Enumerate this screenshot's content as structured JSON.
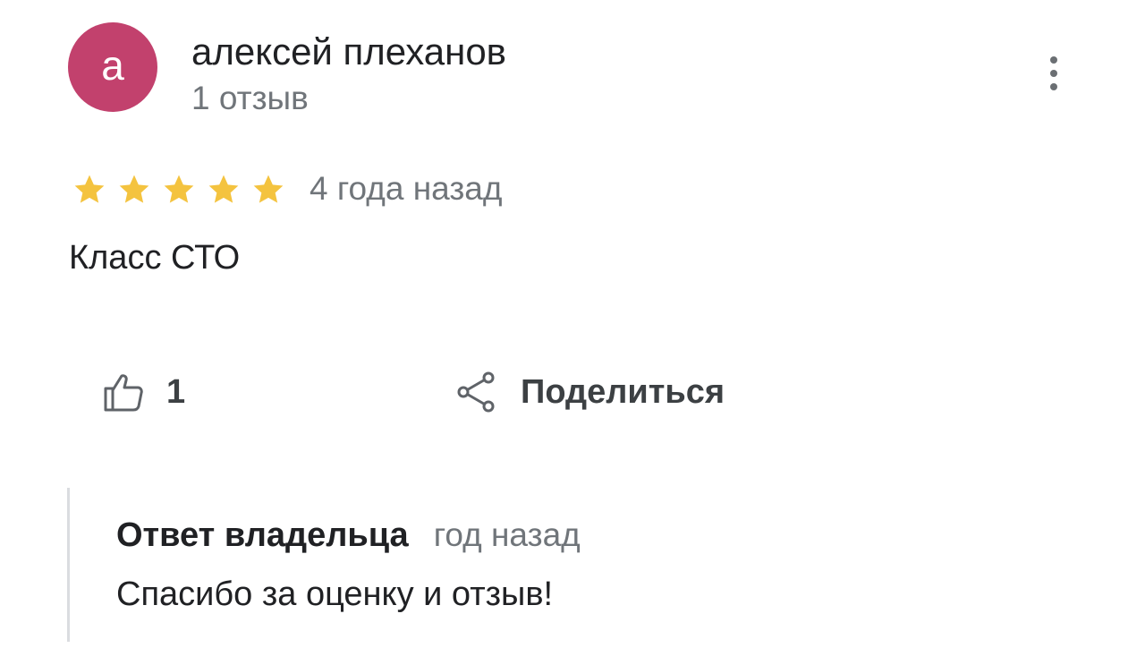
{
  "review": {
    "author": {
      "initial": "а",
      "name": "алексей плеханов",
      "meta": "1 отзыв",
      "avatar_color": "#c2416d"
    },
    "menu_icon": "more-vert-icon",
    "rating": 5,
    "rating_max": 5,
    "star_color": "#f4c33f",
    "date": "4 года назад",
    "text": "Класс СТО",
    "actions": {
      "like_icon": "thumbs-up-icon",
      "like_count": "1",
      "share_icon": "share-icon",
      "share_label": "Поделиться"
    },
    "owner_reply": {
      "label": "Ответ владельца",
      "date": "год назад",
      "text": "Спасибо за оценку и отзыв!"
    }
  }
}
